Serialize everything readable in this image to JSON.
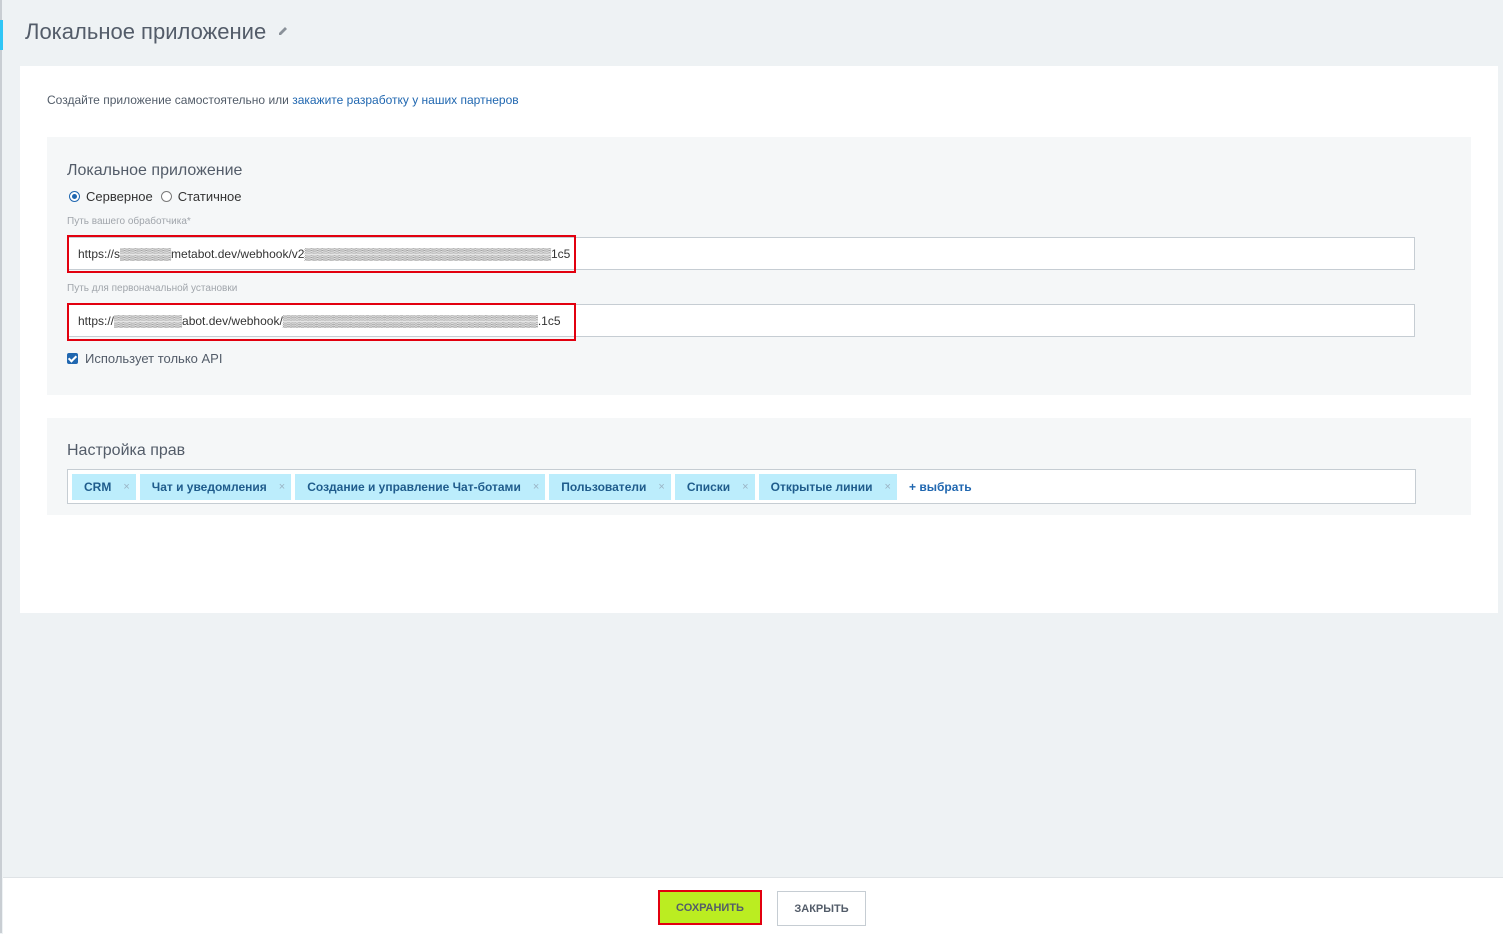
{
  "page": {
    "title": "Локальное приложение"
  },
  "intro": {
    "text": "Создайте приложение самостоятельно или ",
    "link": "закажите разработку у наших партнеров"
  },
  "app_section": {
    "title": "Локальное приложение",
    "type_options": [
      {
        "label": "Серверное",
        "checked": true
      },
      {
        "label": "Статичное",
        "checked": false
      }
    ],
    "handler_path_label": "Путь вашего обработчика*",
    "handler_path_value": "https://s▒▒▒▒▒▒metabot.dev/webhook/v2▒▒▒▒▒▒▒▒▒▒▒▒▒▒▒▒▒▒▒▒▒▒▒▒▒▒▒▒▒1c5",
    "install_path_label": "Путь для первоначальной установки",
    "install_path_value": "https://▒▒▒▒▒▒▒▒abot.dev/webhook/▒▒▒▒▒▒▒▒▒▒▒▒▒▒▒▒▒▒▒▒▒▒▒▒▒▒▒▒▒▒.1c5",
    "api_only_label": "Использует только API",
    "api_only_checked": true
  },
  "rights_section": {
    "title": "Настройка прав",
    "tags": [
      "CRM",
      "Чат и уведомления",
      "Создание и управление Чат-ботами",
      "Пользователи",
      "Списки",
      "Открытые линии"
    ],
    "remove_symbol": "×",
    "add_label": "+ выбрать"
  },
  "footer": {
    "save_label": "СОХРАНИТЬ",
    "close_label": "ЗАКРЫТЬ"
  },
  "colors": {
    "accent": "#2067b0",
    "tag_bg": "#bcedfc",
    "save_bg": "#bbed21",
    "highlight": "#e2000f"
  }
}
